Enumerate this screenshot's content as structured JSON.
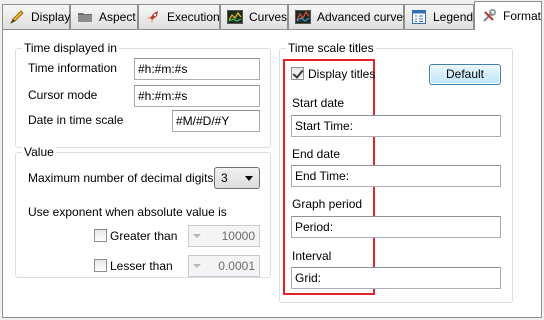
{
  "tabs": [
    {
      "label": "Display",
      "icon": "pencil-icon"
    },
    {
      "label": "Aspect",
      "icon": "folder-icon"
    },
    {
      "label": "Execution",
      "icon": "rocket-icon"
    },
    {
      "label": "Curves",
      "icon": "curves-chart-icon"
    },
    {
      "label": "Advanced curves",
      "icon": "advanced-curves-chart-icon"
    },
    {
      "label": "Legend",
      "icon": "legend-grid-icon"
    },
    {
      "label": "Format",
      "icon": "tools-icon",
      "active": true
    }
  ],
  "time_displayed": {
    "title": "Time displayed in",
    "time_information_label": "Time information",
    "time_information_value": "#h:#m:#s",
    "cursor_mode_label": "Cursor mode",
    "cursor_mode_value": "#h:#m:#s",
    "date_label": "Date in time scale",
    "date_value": "#M/#D/#Y"
  },
  "value": {
    "title": "Value",
    "decimal_label": "Maximum number of decimal digits",
    "decimal_value": "3",
    "exponent_label": "Use exponent when absolute value is",
    "greater_label": "Greater than",
    "greater_value": "10000",
    "lesser_label": "Lesser than",
    "lesser_value": "0.0001"
  },
  "time_scale": {
    "title": "Time scale titles",
    "display_titles_label": "Display titles",
    "display_titles_checked": true,
    "default_button": "Default",
    "start_label": "Start date",
    "start_value": "Start Time:",
    "end_label": "End date",
    "end_value": "End Time:",
    "period_label": "Graph period",
    "period_value": "Period:",
    "interval_label": "Interval",
    "interval_value": "Grid:"
  },
  "colors": {
    "highlight": "#e2232a",
    "group_border": "#d5dfe5",
    "button_blue": "#3c7fb1"
  }
}
